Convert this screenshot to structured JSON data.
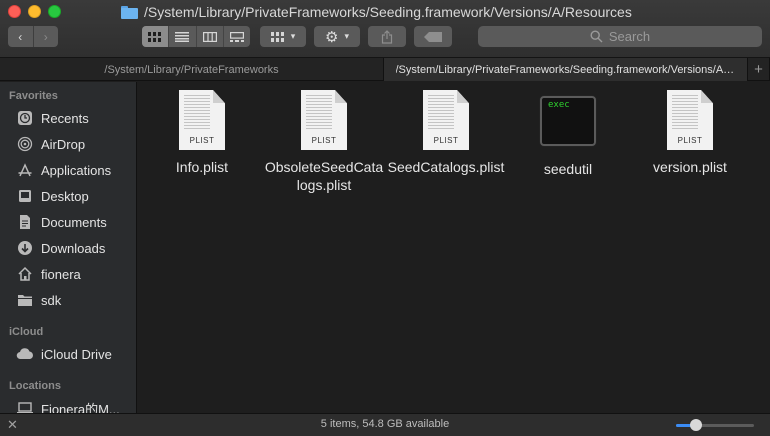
{
  "window": {
    "title": "/System/Library/PrivateFrameworks/Seeding.framework/Versions/A/Resources"
  },
  "toolbar": {
    "back": "‹",
    "forward": "›",
    "search_placeholder": "Search"
  },
  "tabs": [
    {
      "label": "/System/Library/PrivateFrameworks"
    },
    {
      "label": "/System/Library/PrivateFrameworks/Seeding.framework/Versions/A/Resources"
    }
  ],
  "tab_add": "+",
  "sidebar": {
    "favorites_header": "Favorites",
    "favorites": [
      {
        "label": "Recents",
        "icon": "clock-icon"
      },
      {
        "label": "AirDrop",
        "icon": "airdrop-icon"
      },
      {
        "label": "Applications",
        "icon": "applications-icon"
      },
      {
        "label": "Desktop",
        "icon": "desktop-icon"
      },
      {
        "label": "Documents",
        "icon": "document-icon"
      },
      {
        "label": "Downloads",
        "icon": "download-icon"
      },
      {
        "label": "fionera",
        "icon": "home-icon"
      },
      {
        "label": "sdk",
        "icon": "folder-icon"
      }
    ],
    "icloud_header": "iCloud",
    "icloud": [
      {
        "label": "iCloud Drive",
        "icon": "cloud-icon"
      }
    ],
    "locations_header": "Locations",
    "locations": [
      {
        "label": "Fionera的M...",
        "icon": "laptop-icon"
      }
    ]
  },
  "files": [
    {
      "name": "Info.plist",
      "kind": "plist",
      "badge": "PLIST"
    },
    {
      "name": "ObsoleteSeedCatalogs.plist",
      "kind": "plist",
      "badge": "PLIST"
    },
    {
      "name": "SeedCatalogs.plist",
      "kind": "plist",
      "badge": "PLIST"
    },
    {
      "name": "seedutil",
      "kind": "exec",
      "badge": "exec"
    },
    {
      "name": "version.plist",
      "kind": "plist",
      "badge": "PLIST"
    }
  ],
  "status": {
    "text": "5 items, 54.8 GB available",
    "icon_size_level": 0.25
  },
  "colors": {
    "accent": "#3b8cf5",
    "exec_text": "#2ed12e"
  }
}
